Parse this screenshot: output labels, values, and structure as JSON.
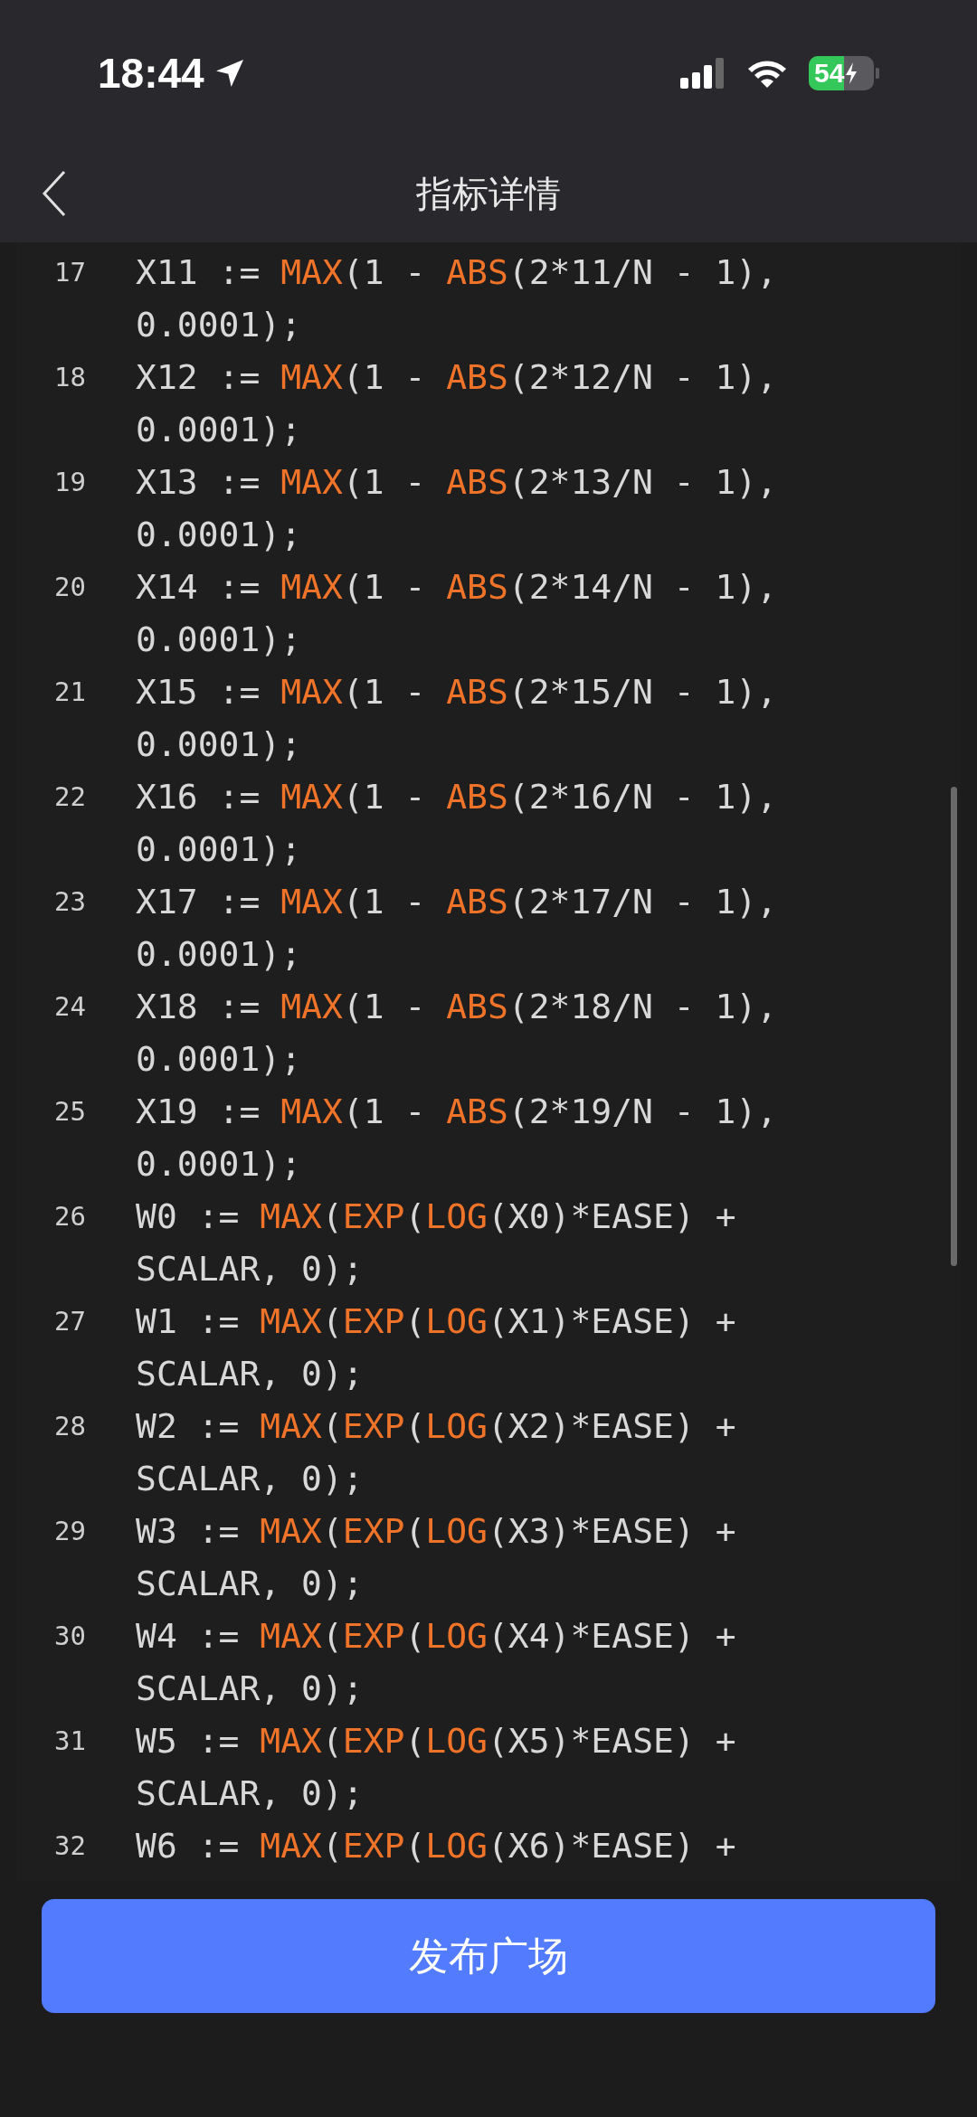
{
  "status_bar": {
    "time": "18:44",
    "battery": "54"
  },
  "header": {
    "title": "指标详情"
  },
  "code": [
    {
      "number": "17",
      "segments": [
        {
          "kind": "plain",
          "text": "X11 := "
        },
        {
          "kind": "fn",
          "text": "MAX"
        },
        {
          "kind": "plain",
          "text": "(1 - "
        },
        {
          "kind": "fn",
          "text": "ABS"
        },
        {
          "kind": "plain",
          "text": "(2*11/N - 1), 0.0001);"
        }
      ]
    },
    {
      "number": "18",
      "segments": [
        {
          "kind": "plain",
          "text": "X12 := "
        },
        {
          "kind": "fn",
          "text": "MAX"
        },
        {
          "kind": "plain",
          "text": "(1 - "
        },
        {
          "kind": "fn",
          "text": "ABS"
        },
        {
          "kind": "plain",
          "text": "(2*12/N - 1), 0.0001);"
        }
      ]
    },
    {
      "number": "19",
      "segments": [
        {
          "kind": "plain",
          "text": "X13 := "
        },
        {
          "kind": "fn",
          "text": "MAX"
        },
        {
          "kind": "plain",
          "text": "(1 - "
        },
        {
          "kind": "fn",
          "text": "ABS"
        },
        {
          "kind": "plain",
          "text": "(2*13/N - 1), 0.0001);"
        }
      ]
    },
    {
      "number": "20",
      "segments": [
        {
          "kind": "plain",
          "text": "X14 := "
        },
        {
          "kind": "fn",
          "text": "MAX"
        },
        {
          "kind": "plain",
          "text": "(1 - "
        },
        {
          "kind": "fn",
          "text": "ABS"
        },
        {
          "kind": "plain",
          "text": "(2*14/N - 1), 0.0001);"
        }
      ]
    },
    {
      "number": "21",
      "segments": [
        {
          "kind": "plain",
          "text": "X15 := "
        },
        {
          "kind": "fn",
          "text": "MAX"
        },
        {
          "kind": "plain",
          "text": "(1 - "
        },
        {
          "kind": "fn",
          "text": "ABS"
        },
        {
          "kind": "plain",
          "text": "(2*15/N - 1), 0.0001);"
        }
      ]
    },
    {
      "number": "22",
      "segments": [
        {
          "kind": "plain",
          "text": "X16 := "
        },
        {
          "kind": "fn",
          "text": "MAX"
        },
        {
          "kind": "plain",
          "text": "(1 - "
        },
        {
          "kind": "fn",
          "text": "ABS"
        },
        {
          "kind": "plain",
          "text": "(2*16/N - 1), 0.0001);"
        }
      ]
    },
    {
      "number": "23",
      "segments": [
        {
          "kind": "plain",
          "text": "X17 := "
        },
        {
          "kind": "fn",
          "text": "MAX"
        },
        {
          "kind": "plain",
          "text": "(1 - "
        },
        {
          "kind": "fn",
          "text": "ABS"
        },
        {
          "kind": "plain",
          "text": "(2*17/N - 1), 0.0001);"
        }
      ]
    },
    {
      "number": "24",
      "segments": [
        {
          "kind": "plain",
          "text": "X18 := "
        },
        {
          "kind": "fn",
          "text": "MAX"
        },
        {
          "kind": "plain",
          "text": "(1 - "
        },
        {
          "kind": "fn",
          "text": "ABS"
        },
        {
          "kind": "plain",
          "text": "(2*18/N - 1), 0.0001);"
        }
      ]
    },
    {
      "number": "25",
      "segments": [
        {
          "kind": "plain",
          "text": "X19 := "
        },
        {
          "kind": "fn",
          "text": "MAX"
        },
        {
          "kind": "plain",
          "text": "(1 - "
        },
        {
          "kind": "fn",
          "text": "ABS"
        },
        {
          "kind": "plain",
          "text": "(2*19/N - 1), 0.0001);"
        }
      ]
    },
    {
      "number": "26",
      "segments": [
        {
          "kind": "plain",
          "text": "W0 := "
        },
        {
          "kind": "fn",
          "text": "MAX"
        },
        {
          "kind": "plain",
          "text": "("
        },
        {
          "kind": "fn",
          "text": "EXP"
        },
        {
          "kind": "plain",
          "text": "("
        },
        {
          "kind": "fn",
          "text": "LOG"
        },
        {
          "kind": "plain",
          "text": "(X0)*EASE) + SCALAR, 0);"
        }
      ]
    },
    {
      "number": "27",
      "segments": [
        {
          "kind": "plain",
          "text": "W1 := "
        },
        {
          "kind": "fn",
          "text": "MAX"
        },
        {
          "kind": "plain",
          "text": "("
        },
        {
          "kind": "fn",
          "text": "EXP"
        },
        {
          "kind": "plain",
          "text": "("
        },
        {
          "kind": "fn",
          "text": "LOG"
        },
        {
          "kind": "plain",
          "text": "(X1)*EASE) + SCALAR, 0);"
        }
      ]
    },
    {
      "number": "28",
      "segments": [
        {
          "kind": "plain",
          "text": "W2 := "
        },
        {
          "kind": "fn",
          "text": "MAX"
        },
        {
          "kind": "plain",
          "text": "("
        },
        {
          "kind": "fn",
          "text": "EXP"
        },
        {
          "kind": "plain",
          "text": "("
        },
        {
          "kind": "fn",
          "text": "LOG"
        },
        {
          "kind": "plain",
          "text": "(X2)*EASE) + SCALAR, 0);"
        }
      ]
    },
    {
      "number": "29",
      "segments": [
        {
          "kind": "plain",
          "text": "W3 := "
        },
        {
          "kind": "fn",
          "text": "MAX"
        },
        {
          "kind": "plain",
          "text": "("
        },
        {
          "kind": "fn",
          "text": "EXP"
        },
        {
          "kind": "plain",
          "text": "("
        },
        {
          "kind": "fn",
          "text": "LOG"
        },
        {
          "kind": "plain",
          "text": "(X3)*EASE) + SCALAR, 0);"
        }
      ]
    },
    {
      "number": "30",
      "segments": [
        {
          "kind": "plain",
          "text": "W4 := "
        },
        {
          "kind": "fn",
          "text": "MAX"
        },
        {
          "kind": "plain",
          "text": "("
        },
        {
          "kind": "fn",
          "text": "EXP"
        },
        {
          "kind": "plain",
          "text": "("
        },
        {
          "kind": "fn",
          "text": "LOG"
        },
        {
          "kind": "plain",
          "text": "(X4)*EASE) + SCALAR, 0);"
        }
      ]
    },
    {
      "number": "31",
      "segments": [
        {
          "kind": "plain",
          "text": "W5 := "
        },
        {
          "kind": "fn",
          "text": "MAX"
        },
        {
          "kind": "plain",
          "text": "("
        },
        {
          "kind": "fn",
          "text": "EXP"
        },
        {
          "kind": "plain",
          "text": "("
        },
        {
          "kind": "fn",
          "text": "LOG"
        },
        {
          "kind": "plain",
          "text": "(X5)*EASE) + SCALAR, 0);"
        }
      ]
    },
    {
      "number": "32",
      "segments": [
        {
          "kind": "plain",
          "text": "W6 := "
        },
        {
          "kind": "fn",
          "text": "MAX"
        },
        {
          "kind": "plain",
          "text": "("
        },
        {
          "kind": "fn",
          "text": "EXP"
        },
        {
          "kind": "plain",
          "text": "("
        },
        {
          "kind": "fn",
          "text": "LOG"
        },
        {
          "kind": "plain",
          "text": "(X6)*EASE) +"
        }
      ]
    }
  ],
  "publish_button": "发布广场"
}
